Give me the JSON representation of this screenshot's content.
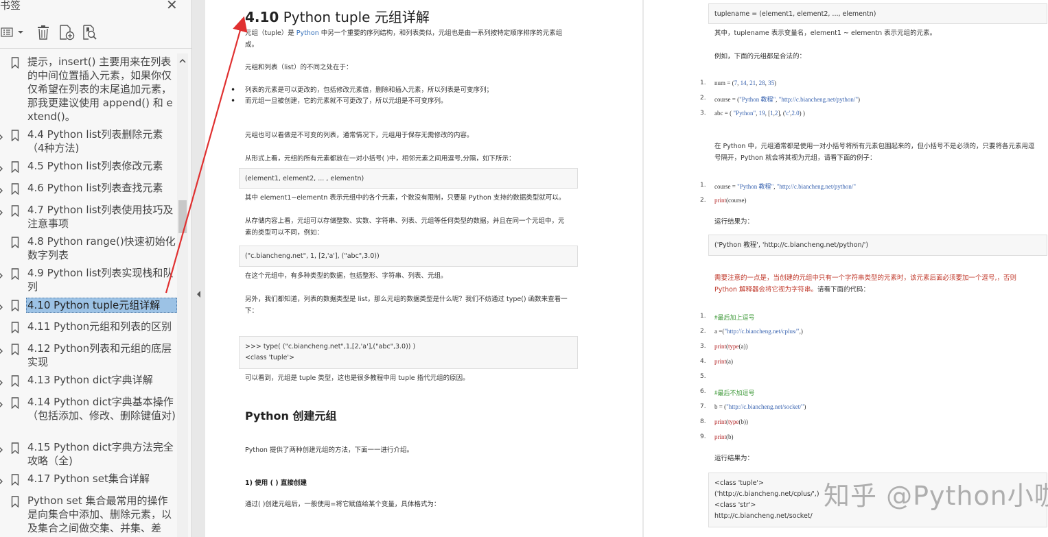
{
  "sidebar": {
    "title": "书签",
    "close_icon": "close-icon",
    "toolbar": [
      {
        "name": "view-options-icon"
      },
      {
        "name": "delete-bookmark-icon"
      },
      {
        "name": "add-bookmark-icon"
      },
      {
        "name": "find-bookmark-icon"
      }
    ],
    "items": [
      {
        "label": "提示，insert() 主要用来在列表的中间位置插入元素，如果你仅仅希望在列表的末尾追加元素，那我更建议使用 append() 和 extend()。",
        "expand": false
      },
      {
        "label": "4.4 Python list列表删除元素（4种方法)",
        "expand": true
      },
      {
        "label": "4.5 Python list列表修改元素",
        "expand": true
      },
      {
        "label": "4.6 Python list列表查找元素",
        "expand": true
      },
      {
        "label": "4.7 Python list列表使用技巧及注意事项",
        "expand": true
      },
      {
        "label": "4.8 Python range()快速初始化数字列表",
        "expand": false
      },
      {
        "label": "4.9 Python list列表实现栈和队列",
        "expand": true
      },
      {
        "label": "4.10 Python tuple元组详解",
        "expand": true,
        "selected": true
      },
      {
        "label": "4.11 Python元组和列表的区别",
        "expand": false
      },
      {
        "label": "4.12 Python列表和元组的底层实现",
        "expand": true
      },
      {
        "label": "4.13 Python dict字典详解",
        "expand": true
      },
      {
        "label": "4.14 Python dict字典基本操作（包括添加、修改、删除键值对)",
        "expand": true
      },
      {
        "label": "4.15 Python dict字典方法完全攻略（全)",
        "expand": true
      },
      {
        "label": "4.17 Python set集合详解",
        "expand": true
      },
      {
        "label": "Python set 集合最常用的操作是向集合中添加、删除元素，以及集合之间做交集、并集、差",
        "expand": false
      }
    ]
  },
  "page1": {
    "title_num": "4.10",
    "title_text": " Python tuple 元组详解",
    "intro_a": "元组（tuple）是 ",
    "intro_link": "Python",
    "intro_b": " 中另一个重要的序列结构，和列表类似，元组也是由一系列按特定顺序排序的元素组成。",
    "diff_intro": "元组和列表（list）的不同之处在于：",
    "bullet1": "列表的元素是可以更改的，包括修改元素值，删除和插入元素，所以列表是可变序列；",
    "bullet2": "而元组一旦被创建，它的元素就不可更改了，所以元组是不可变序列。",
    "p_immutable": "元组也可以看做是不可变的列表，通常情况下，元组用于保存无需修改的内容。",
    "p_form": "从形式上看，元组的所有元素都放在一对小括号( )中，相邻元素之间用逗号,分隔，如下所示：",
    "code1": "(element1, element2, ... , elementn)",
    "p_elements": "其中 element1~elementn 表示元组中的各个元素，个数没有限制，只要是 Python 支持的数据类型就可以。",
    "p_store": "从存储内容上看，元组可以存储整数、实数、字符串、列表、元组等任何类型的数据，并且在同一个元组中，元素的类型可以不同，例如：",
    "code2": "(\"c.biancheng.net\", 1, [2,'a'], (\"abc\",3.0))",
    "p_types": "在这个元组中，有多种类型的数据，包括整形、字符串、列表、元组。",
    "p_type_fn": "另外，我们都知道，列表的数据类型是 list，那么元组的数据类型是什么呢？我们不妨通过 type() 函数来查看一下：",
    "code3_l1": ">>> type( (\"c.biancheng.net\",1,[2,'a'],(\"abc\",3.0)) )",
    "code3_l2": "<class 'tuple'>",
    "p_seen": "可以看到，元组是 tuple 类型，这也是很多教程中用 tuple 指代元组的原因。",
    "h2_create": "Python 创建元组",
    "p_two_ways": "Python 提供了两种创建元组的方法，下面一一进行介绍。",
    "h3_direct": "1) 使用 ( ) 直接创建",
    "p_assign": "通过( )创建元组后，一般使用=将它赋值给某个变量，具体格式为："
  },
  "page2": {
    "code_syntax": "tuplename = (element1, element2, ..., elementn)",
    "p_where": "其中，tuplename 表示变量名，element1 ~ elementn 表示元组的元素。",
    "p_example": "例如，下面的元组都是合法的：",
    "codeA": [
      {
        "n": "1.",
        "text": "num = (7, 14, 21, 28, 35)"
      },
      {
        "n": "2.",
        "text": "course = (\"Python 教程\", \"http://c.biancheng.net/python/\")"
      },
      {
        "n": "3.",
        "text": "abc = ( \"Python\", 19, [1,2], ('c',2.0) )"
      }
    ],
    "p_paren": "在 Python 中，元组通常都是使用一对小括号将所有元素包围起来的，但小括号不是必须的，只要将各元素用逗号隔开，Python 就会将其视为元组，请看下面的例子：",
    "codeB": [
      {
        "n": "1.",
        "text": "course = \"Python 教程\", \"http://c.biancheng.net/python/\""
      },
      {
        "n": "2.",
        "text": "print(course)"
      }
    ],
    "p_result1": "运行结果为：",
    "code_result1": "('Python 教程', 'http://c.biancheng.net/python/')",
    "p_note": "需要注意的一点是，当创建的元组中只有一个字符串类型的元素时，该元素后面必须要加一个逗号,，否则 Python 解释器会将它视为字符串。",
    "p_note_tail": "请看下面的代码：",
    "codeC": [
      {
        "n": "1.",
        "text": "#最后加上逗号"
      },
      {
        "n": "2.",
        "text": "a =(\"http://c.biancheng.net/cplus/\",)"
      },
      {
        "n": "3.",
        "text": "print(type(a))"
      },
      {
        "n": "4.",
        "text": "print(a)"
      },
      {
        "n": "5.",
        "text": ""
      },
      {
        "n": "6.",
        "text": "#最后不加逗号"
      },
      {
        "n": "7.",
        "text": "b = (\"http://c.biancheng.net/socket/\")"
      },
      {
        "n": "8.",
        "text": "print(type(b))"
      },
      {
        "n": "9.",
        "text": "print(b)"
      }
    ],
    "p_result2": "运行结果为：",
    "result2": [
      "<class 'tuple'>",
      "('http://c.biancheng.net/cplus/',)",
      "<class 'str'>",
      "http://c.biancheng.net/socket/"
    ]
  },
  "watermark": "知乎 @Python小咖",
  "colors": {
    "selection": "#9cc2e5",
    "link": "#2e6bb8",
    "annotation": "#e03030",
    "warning": "#c0392b"
  }
}
